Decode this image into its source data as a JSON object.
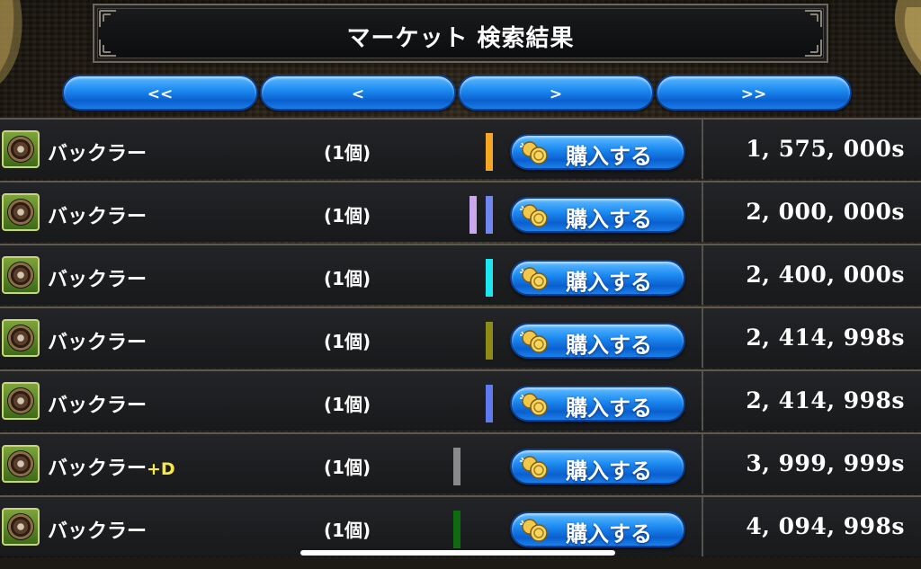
{
  "header": {
    "title": "マーケット 検索結果"
  },
  "nav": {
    "first_label": "<<",
    "prev_label": "<",
    "next_label": ">",
    "last_label": ">>"
  },
  "buy_label": "購入する",
  "icons": {
    "item": "buckler-shield-icon",
    "coin": "coin-icon"
  },
  "listings": [
    {
      "name": "バックラー",
      "suffix": "",
      "qty": "(1個)",
      "markers": [
        "#f5a623"
      ],
      "price": "1, 575, 000s"
    },
    {
      "name": "バックラー",
      "suffix": "",
      "qty": "(1個)",
      "markers": [
        "#c9a8f0",
        "#6f87ee"
      ],
      "price": "2, 000, 000s"
    },
    {
      "name": "バックラー",
      "suffix": "",
      "qty": "(1個)",
      "markers": [
        "#1ee6f0"
      ],
      "price": "2, 400, 000s"
    },
    {
      "name": "バックラー",
      "suffix": "",
      "qty": "(1個)",
      "markers": [
        "#8e8a16"
      ],
      "price": "2, 414, 998s"
    },
    {
      "name": "バックラー",
      "suffix": "",
      "qty": "(1個)",
      "markers": [
        "#5f7af0"
      ],
      "price": "2, 414, 998s"
    },
    {
      "name": "バックラー",
      "suffix": "+D",
      "qty": "(1個)",
      "markers": [
        "#8a8a8a"
      ],
      "price": "3, 999, 999s"
    },
    {
      "name": "バックラー",
      "suffix": "",
      "qty": "(1個)",
      "markers": [
        "#0f6b12"
      ],
      "price": "4, 094, 998s"
    }
  ]
}
